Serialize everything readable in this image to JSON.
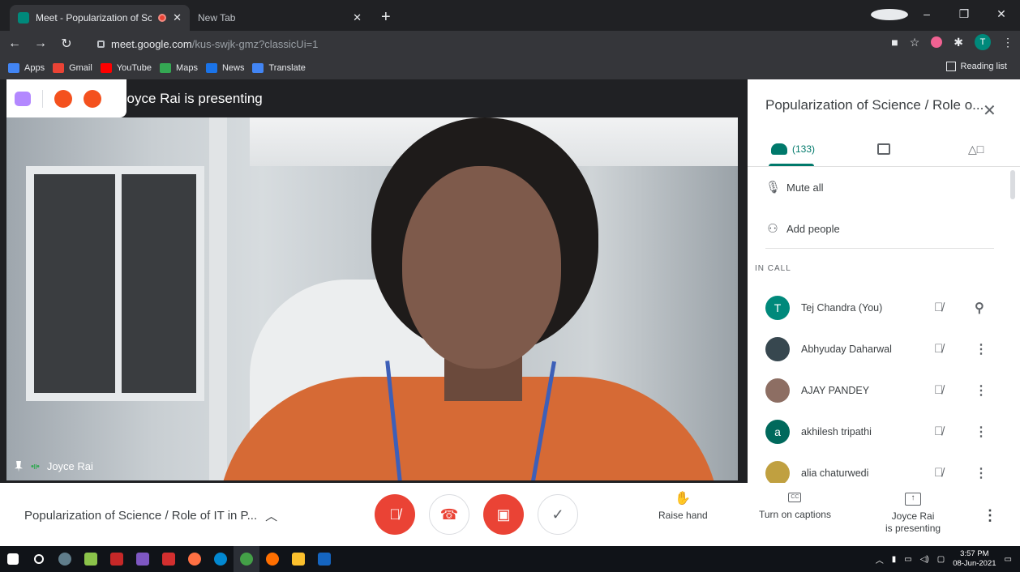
{
  "browser": {
    "tabs": [
      {
        "title": "Meet - Popularization of Scienc",
        "active": true
      },
      {
        "title": "New Tab",
        "active": false
      }
    ],
    "url_host": "meet.google.com",
    "url_path": "/kus-swjk-gmz?classicUi=1",
    "profile_initial": "T",
    "bookmarks": [
      {
        "label": "Apps",
        "color": "#4285f4"
      },
      {
        "label": "Gmail",
        "color": "#ea4335"
      },
      {
        "label": "YouTube",
        "color": "#ff0000"
      },
      {
        "label": "Maps",
        "color": "#34a853"
      },
      {
        "label": "News",
        "color": "#1a73e8"
      },
      {
        "label": "Translate",
        "color": "#4285f4"
      }
    ],
    "reading_list": "Reading list"
  },
  "meet": {
    "presenting_banner": "Joyce Rai is presenting",
    "tile_name": "Joyce Rai",
    "meeting_title": "Popularization of Science / Role of IT in P...",
    "raise_hand": "Raise hand",
    "captions": "Turn on captions",
    "presenter_line1": "Joyce Rai",
    "presenter_line2": "is presenting"
  },
  "panel": {
    "title": "Popularization of Science / Role o...",
    "people_count": "(133)",
    "mute_all": "Mute all",
    "add_people": "Add people",
    "in_call": "IN CALL",
    "participants": [
      {
        "name": "Tej Chandra (You)",
        "initial": "T",
        "color": "#00897b",
        "action": "pin"
      },
      {
        "name": "Abhyuday Daharwal",
        "initial": "",
        "color": "#37474f",
        "action": "more"
      },
      {
        "name": "AJAY PANDEY",
        "initial": "",
        "color": "#8d6e63",
        "action": "more"
      },
      {
        "name": "akhilesh tripathi",
        "initial": "a",
        "color": "#00695c",
        "action": "more"
      },
      {
        "name": "alia chaturwedi",
        "initial": "",
        "color": "#c0a040",
        "action": "more"
      }
    ]
  },
  "taskbar": {
    "time": "3:57 PM",
    "date": "08-Jun-2021"
  },
  "colors": {
    "accent": "#00796b",
    "danger": "#ea4335"
  }
}
